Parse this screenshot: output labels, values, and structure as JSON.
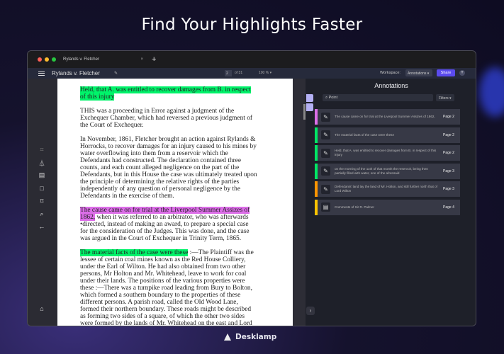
{
  "headline": "Find Your Highlights Faster",
  "brand": "Desklamp",
  "tab": {
    "title": "Rylands v. Fletcher",
    "close": "×",
    "new": "+"
  },
  "toolbar": {
    "title": "Rylands v. Fletcher",
    "page": "2",
    "of": "of 31",
    "zoom": "100 % ▾",
    "workspace_label": "Workspace:",
    "workspace": "Annotations ▾",
    "share": "Share",
    "add": "+"
  },
  "document": {
    "p1": "Held, that A. was entitled to recover damages from B. in respect of this injury",
    "p2": "THIS was a proceeding in Error against a judgment of the Exchequer Chamber, which had reversed a previous judgment of the Court of Exchequer.",
    "p3": "In November, 1861, Fletcher brought an action against Rylands & Horrocks, to recover damages for an injury caused to his mines by water overflowing into them from a reservoir which the Defendants had constructed. The declaration contained three counts, and each count alleged negligence on the part of the Defendants, but in this House the case was ultimately treated upon the principle of determining the relative rights of the parties independently of any question of personal negligence by the Defendants in the exercise of them.",
    "p4_hl": "The cause came on for trial at the Liverpool Summer Assizes of 1862,",
    "p4": " when it was referred to an arbitrator, who was afterwards •directed, instead of making an award, to prepare a special case for the consideration of the Judges. This was done, and the case was argued in the Court of Exchequer in Trinity Term, 1865.",
    "p5_hl": "The material facts of the case were these",
    "p5": " :—The Plaintiff was the lessee of certain coal mines known as the Red House Colliery, under the Earl of Wilton. He had also obtained from two other persons, Mr Holton and Mr. Whitehead, leave to work for coal under their lands. The positions of the various properties were these :—There was a turnpike road leading from Bury to Bolton, which formed a southern boundary to the properties of these different persons. A parish road, called the Old Wood Lane, formed their northern boundary. These roads might be described as forming two sides of a square, of which the other two sides were formed by the lands of Mr. Whitehead on the east and Lord Wilton on the west. The Defendants' grounds lay along the turnpike road, or southern boundary, stretching from its centre westward. On these grounds were a mill and a"
  },
  "panel": {
    "title": "Annotations",
    "search": "Point",
    "filters": "Filters ▾",
    "expand": "›",
    "items": [
      {
        "text": "The cause came on for trial at the Liverpool Summer Assizes of 1862,",
        "page": "Page 2",
        "color": "#dc6ee8",
        "icon": "✎"
      },
      {
        "text": "The material facts of the case were these",
        "page": "Page 2",
        "color": "#00e865",
        "icon": "✎"
      },
      {
        "text": "Held, that A. was entitled to recover damages from B. in respect of this injury",
        "page": "Page 2",
        "color": "#00e865",
        "icon": "✎"
      },
      {
        "text": "on the morning of the 11th of that month the reservoir, being then partially filled with water, one of the aforesaid",
        "page": "Page 3",
        "color": "#00e865",
        "icon": "✎"
      },
      {
        "text": "Defendants' land lay the land of Mr. Holton, and still further north that of Lord Wilton",
        "page": "Page 3",
        "color": "#ff9500",
        "icon": "✎"
      },
      {
        "text": "Comments of Sir R. Palmer",
        "page": "Page 4",
        "color": "#ffc400",
        "icon": "▤"
      }
    ]
  }
}
